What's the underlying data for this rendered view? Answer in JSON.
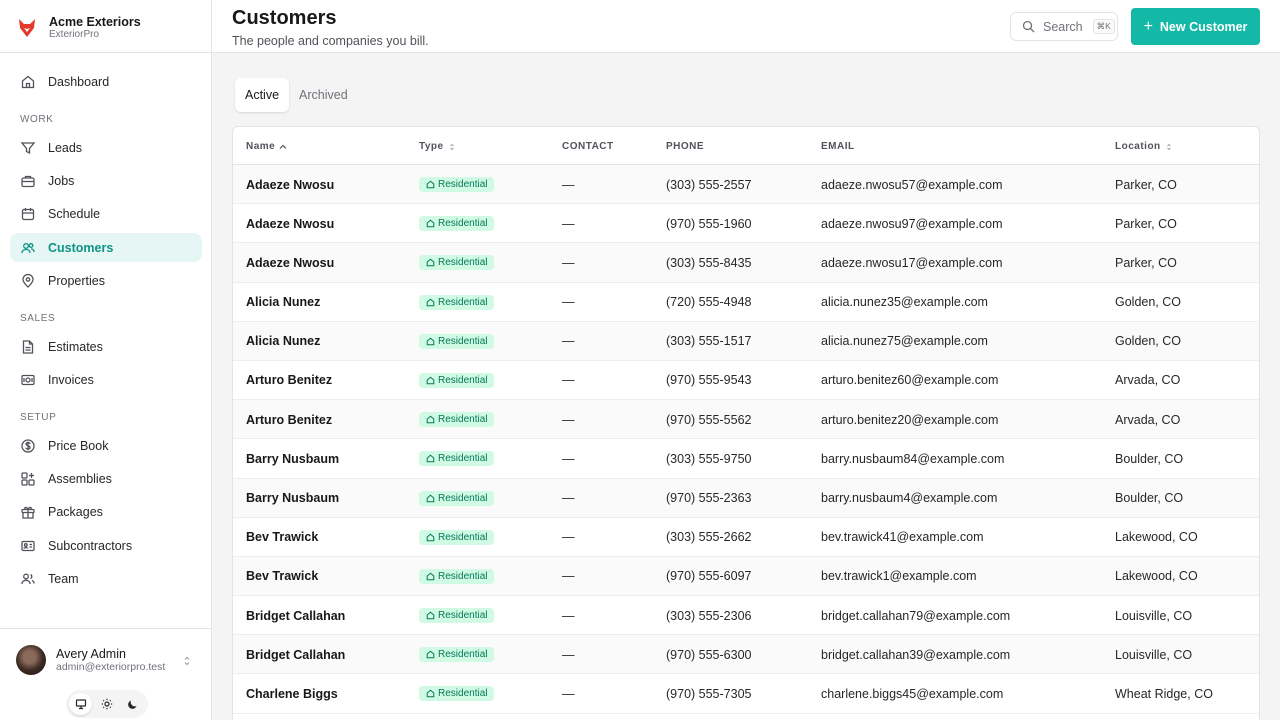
{
  "brand": {
    "name": "Acme Exteriors",
    "product": "ExteriorPro",
    "logo_icon": "fox-logo-icon",
    "logo_color": "#e23b2e"
  },
  "nav": {
    "dashboard": "Dashboard",
    "work_label": "WORK",
    "leads": "Leads",
    "jobs": "Jobs",
    "schedule": "Schedule",
    "customers": "Customers",
    "properties": "Properties",
    "sales_label": "SALES",
    "estimates": "Estimates",
    "invoices": "Invoices",
    "setup_label": "SETUP",
    "price_book": "Price Book",
    "assemblies": "Assemblies",
    "packages": "Packages",
    "subcontractors": "Subcontractors",
    "team": "Team",
    "active_item": "Customers"
  },
  "user": {
    "name": "Avery Admin",
    "email": "admin@exteriorpro.test"
  },
  "theme": {
    "options": [
      "system",
      "light",
      "dark"
    ],
    "active": "system"
  },
  "header": {
    "title": "Customers",
    "subtitle": "The people and companies you bill.",
    "search_placeholder": "Search",
    "search_shortcut": "⌘K",
    "new_button": "New Customer"
  },
  "tabs": {
    "active": "Active",
    "archived": "Archived",
    "selected": "Active"
  },
  "colors": {
    "accent": "#14b8a6",
    "badge_bg": "#d1fae5",
    "badge_text": "#047857"
  },
  "table": {
    "columns": {
      "name": "Name",
      "type": "Type",
      "contact": "CONTACT",
      "phone": "PHONE",
      "email": "EMAIL",
      "location": "Location"
    },
    "sort": {
      "column": "Name",
      "direction": "ascending"
    },
    "rows": [
      {
        "name": "Adaeze Nwosu",
        "type": "Residential",
        "contact": "—",
        "phone": "(303) 555-2557",
        "email": "adaeze.nwosu57@example.com",
        "location": "Parker, CO"
      },
      {
        "name": "Adaeze Nwosu",
        "type": "Residential",
        "contact": "—",
        "phone": "(970) 555-1960",
        "email": "adaeze.nwosu97@example.com",
        "location": "Parker, CO"
      },
      {
        "name": "Adaeze Nwosu",
        "type": "Residential",
        "contact": "—",
        "phone": "(303) 555-8435",
        "email": "adaeze.nwosu17@example.com",
        "location": "Parker, CO"
      },
      {
        "name": "Alicia Nunez",
        "type": "Residential",
        "contact": "—",
        "phone": "(720) 555-4948",
        "email": "alicia.nunez35@example.com",
        "location": "Golden, CO"
      },
      {
        "name": "Alicia Nunez",
        "type": "Residential",
        "contact": "—",
        "phone": "(303) 555-1517",
        "email": "alicia.nunez75@example.com",
        "location": "Golden, CO"
      },
      {
        "name": "Arturo Benitez",
        "type": "Residential",
        "contact": "—",
        "phone": "(970) 555-9543",
        "email": "arturo.benitez60@example.com",
        "location": "Arvada, CO"
      },
      {
        "name": "Arturo Benitez",
        "type": "Residential",
        "contact": "—",
        "phone": "(970) 555-5562",
        "email": "arturo.benitez20@example.com",
        "location": "Arvada, CO"
      },
      {
        "name": "Barry Nusbaum",
        "type": "Residential",
        "contact": "—",
        "phone": "(303) 555-9750",
        "email": "barry.nusbaum84@example.com",
        "location": "Boulder, CO"
      },
      {
        "name": "Barry Nusbaum",
        "type": "Residential",
        "contact": "—",
        "phone": "(970) 555-2363",
        "email": "barry.nusbaum4@example.com",
        "location": "Boulder, CO"
      },
      {
        "name": "Bev Trawick",
        "type": "Residential",
        "contact": "—",
        "phone": "(303) 555-2662",
        "email": "bev.trawick41@example.com",
        "location": "Lakewood, CO"
      },
      {
        "name": "Bev Trawick",
        "type": "Residential",
        "contact": "—",
        "phone": "(970) 555-6097",
        "email": "bev.trawick1@example.com",
        "location": "Lakewood, CO"
      },
      {
        "name": "Bridget Callahan",
        "type": "Residential",
        "contact": "—",
        "phone": "(303) 555-2306",
        "email": "bridget.callahan79@example.com",
        "location": "Louisville, CO"
      },
      {
        "name": "Bridget Callahan",
        "type": "Residential",
        "contact": "—",
        "phone": "(970) 555-6300",
        "email": "bridget.callahan39@example.com",
        "location": "Louisville, CO"
      },
      {
        "name": "Charlene Biggs",
        "type": "Residential",
        "contact": "—",
        "phone": "(970) 555-7305",
        "email": "charlene.biggs45@example.com",
        "location": "Wheat Ridge, CO"
      }
    ]
  }
}
